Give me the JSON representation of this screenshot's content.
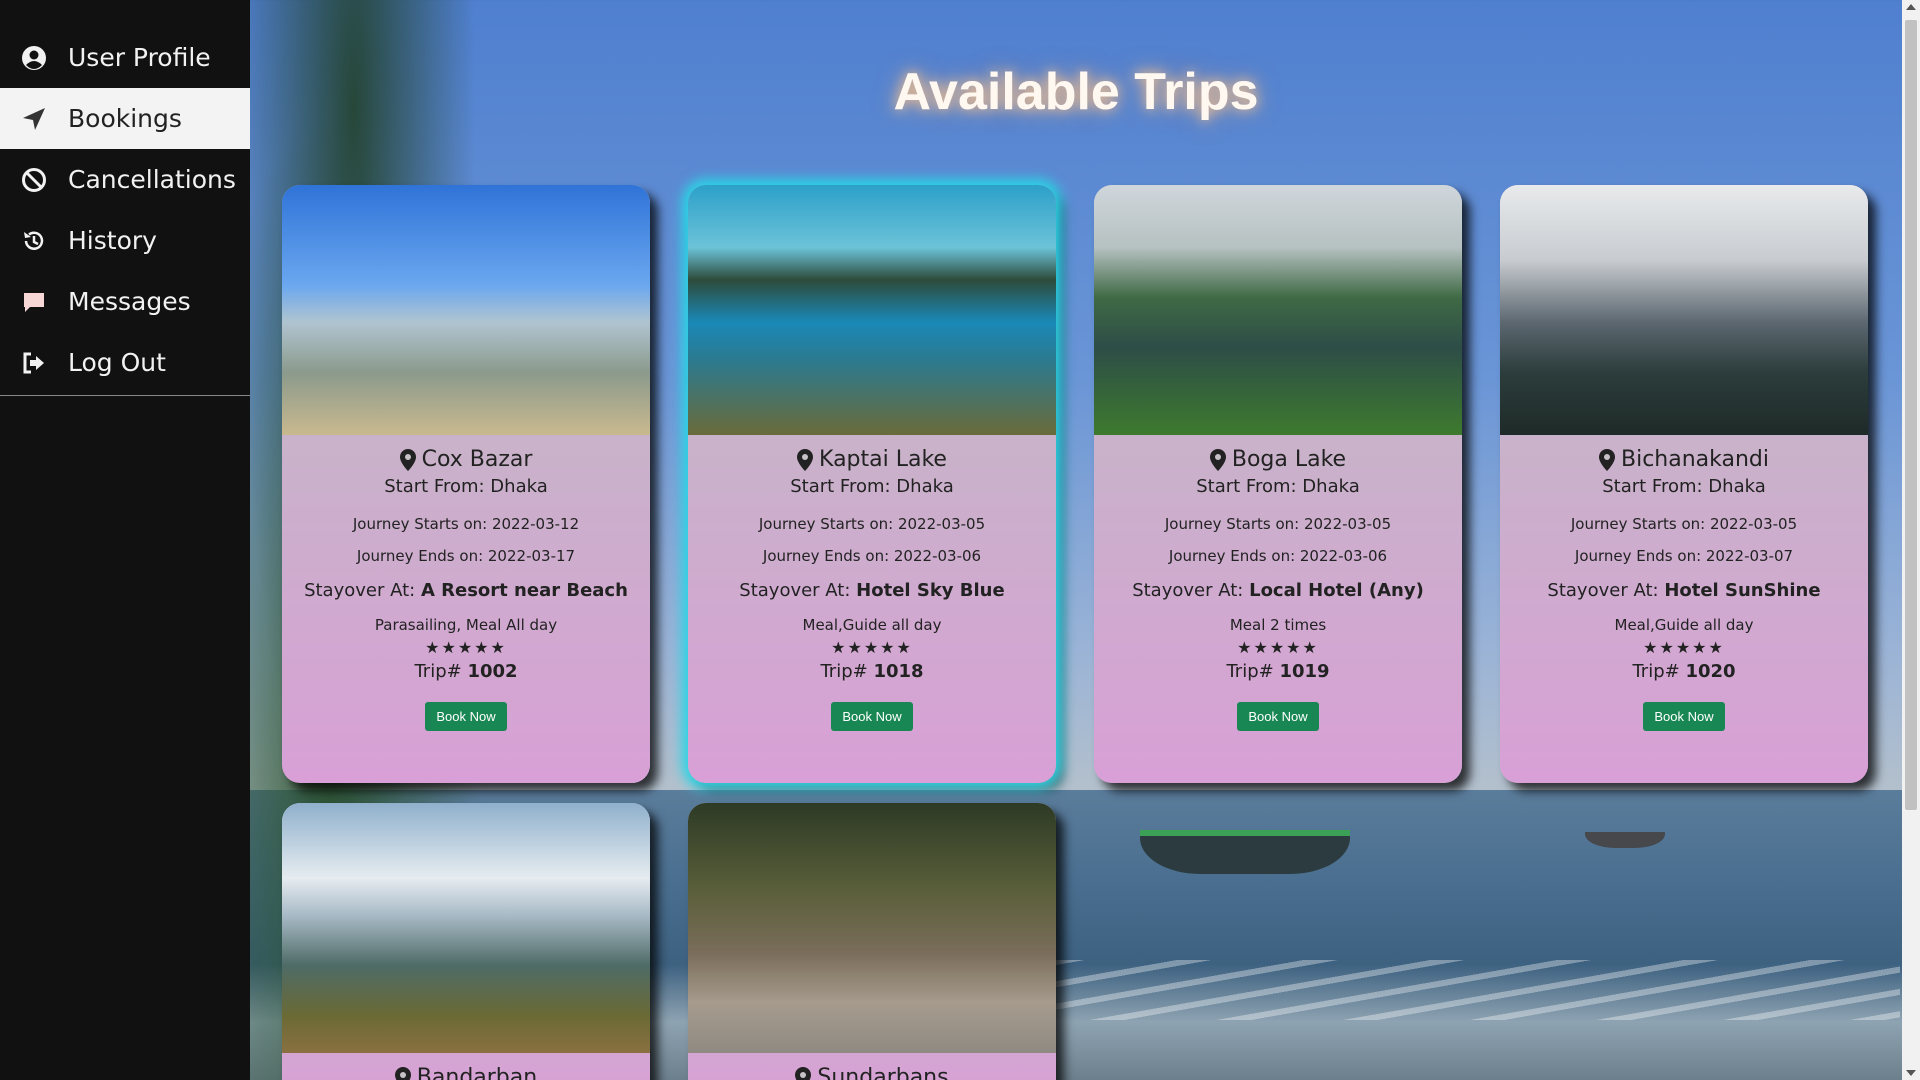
{
  "sidebar": {
    "items": [
      {
        "label": "User Profile",
        "icon": "user-circle-icon",
        "active": false
      },
      {
        "label": "Bookings",
        "icon": "paper-plane-icon",
        "active": true
      },
      {
        "label": "Cancellations",
        "icon": "ban-icon",
        "active": false
      },
      {
        "label": "History",
        "icon": "history-icon",
        "active": false
      },
      {
        "label": "Messages",
        "icon": "message-icon",
        "active": false
      },
      {
        "label": "Log Out",
        "icon": "sign-out-icon",
        "active": false
      }
    ]
  },
  "page": {
    "title": "Available Trips"
  },
  "colors": {
    "sidebar_bg": "#111111",
    "button_green": "#198754",
    "card_glow": "#29d6e6",
    "card_gradient_bottom": "#d8a0d6"
  },
  "trips": [
    {
      "location": "Cox Bazar",
      "start_from": "Start From: Dhaka",
      "journey_start": "Journey Starts on: 2022-03-12",
      "journey_end": "Journey Ends on: 2022-03-17",
      "stayover_label": "Stayover At:",
      "stayover": "A Resort near Beach",
      "features": "Parasailing, Meal All day",
      "rating": 5,
      "trip_label": "Trip#",
      "trip_no": "1002",
      "button": "Book Now"
    },
    {
      "location": "Kaptai Lake",
      "start_from": "Start From: Dhaka",
      "journey_start": "Journey Starts on: 2022-03-05",
      "journey_end": "Journey Ends on: 2022-03-06",
      "stayover_label": "Stayover At:",
      "stayover": "Hotel Sky Blue",
      "features": "Meal,Guide all day",
      "rating": 5,
      "trip_label": "Trip#",
      "trip_no": "1018",
      "button": "Book Now"
    },
    {
      "location": "Boga Lake",
      "start_from": "Start From: Dhaka",
      "journey_start": "Journey Starts on: 2022-03-05",
      "journey_end": "Journey Ends on: 2022-03-06",
      "stayover_label": "Stayover At:",
      "stayover": "Local Hotel (Any)",
      "features": "Meal 2 times",
      "rating": 5,
      "trip_label": "Trip#",
      "trip_no": "1019",
      "button": "Book Now"
    },
    {
      "location": "Bichanakandi",
      "start_from": "Start From: Dhaka",
      "journey_start": "Journey Starts on: 2022-03-05",
      "journey_end": "Journey Ends on: 2022-03-07",
      "stayover_label": "Stayover At:",
      "stayover": "Hotel SunShine",
      "features": "Meal,Guide all day",
      "rating": 5,
      "trip_label": "Trip#",
      "trip_no": "1020",
      "button": "Book Now"
    },
    {
      "location": "Bandarban"
    },
    {
      "location": "Sundarbans"
    }
  ]
}
